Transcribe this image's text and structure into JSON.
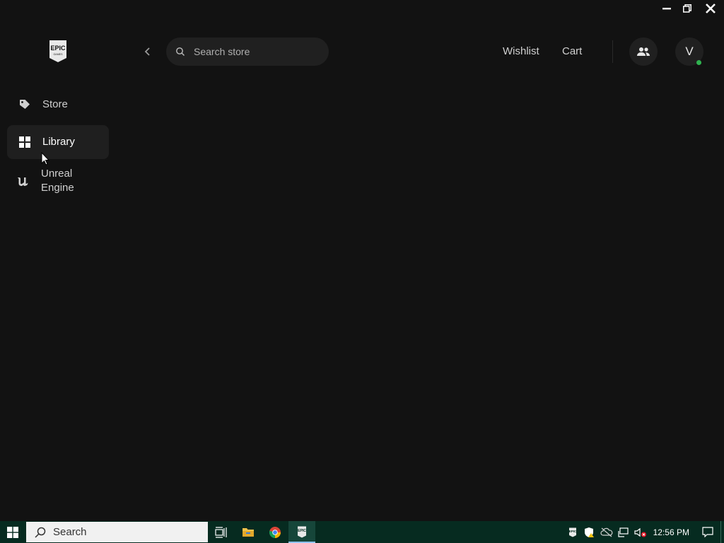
{
  "window": {
    "controls": [
      "minimize-icon",
      "restore-icon",
      "close-icon"
    ]
  },
  "header": {
    "search_placeholder": "Search store",
    "wishlist_label": "Wishlist",
    "cart_label": "Cart",
    "avatar_initial": "V",
    "online_status_color": "#2fb34f"
  },
  "sidebar": {
    "items": [
      {
        "label": "Store",
        "icon": "tag-icon",
        "active": false
      },
      {
        "label": "Library",
        "icon": "grid-icon",
        "active": true
      },
      {
        "label": "Unreal Engine",
        "icon": "unreal-engine-icon",
        "active": false
      }
    ]
  },
  "taskbar": {
    "search_label": "Search",
    "clock": "12:56 PM",
    "apps": [
      "task-view-icon",
      "file-explorer-icon",
      "chrome-icon",
      "epic-games-icon"
    ],
    "accent": "#062b20"
  }
}
